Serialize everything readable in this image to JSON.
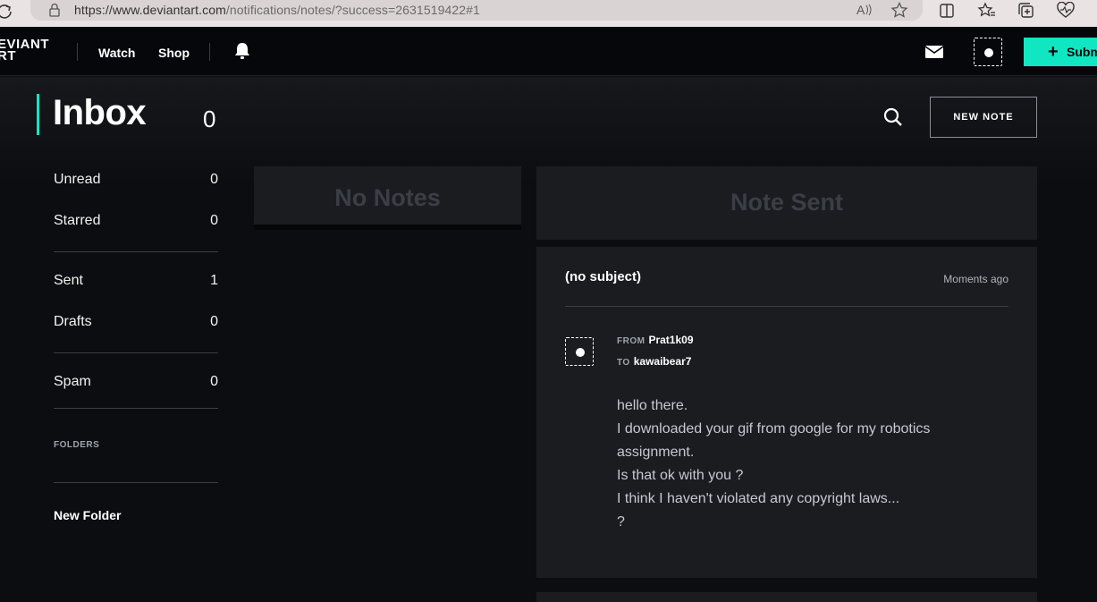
{
  "browser": {
    "url_host": "https://www.deviantart.com",
    "url_path": "/notifications/notes/?success=2631519422#1"
  },
  "nav": {
    "logo_line1": "EVIANT",
    "logo_line2": "RT",
    "watch": "Watch",
    "shop": "Shop",
    "submit": "Subm"
  },
  "header": {
    "title": "Inbox",
    "count": "0",
    "new_note": "NEW NOTE"
  },
  "sidebar": {
    "items": [
      {
        "label": "Unread",
        "count": "0"
      },
      {
        "label": "Starred",
        "count": "0"
      },
      {
        "label": "Sent",
        "count": "1"
      },
      {
        "label": "Drafts",
        "count": "0"
      },
      {
        "label": "Spam",
        "count": "0"
      }
    ],
    "folders_label": "FOLDERS",
    "new_folder": "New Folder"
  },
  "list": {
    "empty_label": "No Notes"
  },
  "note": {
    "banner": "Note Sent",
    "subject": "(no subject)",
    "time": "Moments ago",
    "from_label": "FROM",
    "from": "Prat1k09",
    "to_label": "TO",
    "to": "kawaibear7",
    "lines": [
      "hello there.",
      "I downloaded your gif from google for my robotics assignment.",
      "Is that ok with you ?",
      "I think I haven't violated any copyright laws...",
      "?"
    ]
  },
  "colors": {
    "accent": "#10e6c2",
    "background": "#0b0d10",
    "panel": "#1a1c20"
  }
}
